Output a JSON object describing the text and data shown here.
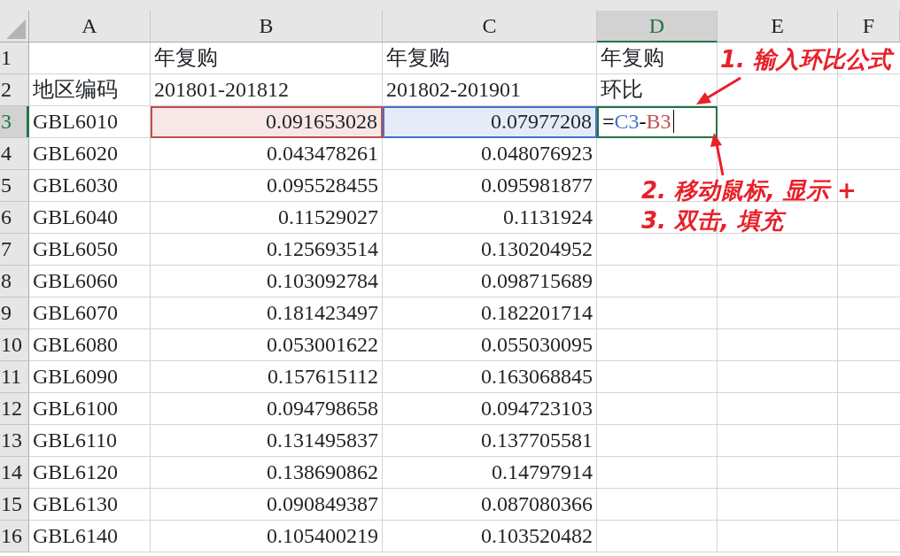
{
  "columns": [
    {
      "label": "A",
      "selected": false
    },
    {
      "label": "B",
      "selected": false
    },
    {
      "label": "C",
      "selected": false
    },
    {
      "label": "D",
      "selected": true
    },
    {
      "label": "E",
      "selected": false
    },
    {
      "label": "F",
      "selected": false
    }
  ],
  "rows": [
    {
      "label": "1",
      "selected": false,
      "cells": [
        "",
        "年复购",
        "年复购",
        "年复购"
      ]
    },
    {
      "label": "2",
      "selected": false,
      "cells": [
        "地区编码",
        "201801-201812",
        "201802-201901",
        "环比"
      ]
    },
    {
      "label": "3",
      "selected": true,
      "cells": [
        "GBL6010",
        {
          "text": "0.091653028",
          "color": "#c0504d"
        },
        {
          "text": "0.07977208",
          "color": "#4472c4"
        },
        {
          "editing": true,
          "formula": [
            {
              "text": "=",
              "color": "#000000"
            },
            {
              "text": "C3",
              "color": "#4472c4"
            },
            {
              "text": "-",
              "color": "#000000"
            },
            {
              "text": "B3",
              "color": "#c0504d"
            }
          ]
        }
      ]
    },
    {
      "label": "4",
      "selected": false,
      "cells": [
        "GBL6020",
        "0.043478261",
        "0.048076923"
      ]
    },
    {
      "label": "5",
      "selected": false,
      "cells": [
        "GBL6030",
        "0.095528455",
        "0.095981877"
      ]
    },
    {
      "label": "6",
      "selected": false,
      "cells": [
        "GBL6040",
        "0.11529027",
        "0.1131924"
      ]
    },
    {
      "label": "7",
      "selected": false,
      "cells": [
        "GBL6050",
        "0.125693514",
        "0.130204952"
      ]
    },
    {
      "label": "8",
      "selected": false,
      "cells": [
        "GBL6060",
        "0.103092784",
        "0.098715689"
      ]
    },
    {
      "label": "9",
      "selected": false,
      "cells": [
        "GBL6070",
        "0.181423497",
        "0.182201714"
      ]
    },
    {
      "label": "10",
      "selected": false,
      "cells": [
        "GBL6080",
        "0.053001622",
        "0.055030095"
      ]
    },
    {
      "label": "11",
      "selected": false,
      "cells": [
        "GBL6090",
        "0.157615112",
        "0.163068845"
      ]
    },
    {
      "label": "12",
      "selected": false,
      "cells": [
        "GBL6100",
        "0.094798658",
        "0.094723103"
      ]
    },
    {
      "label": "13",
      "selected": false,
      "cells": [
        "GBL6110",
        "0.131495837",
        "0.137705581"
      ]
    },
    {
      "label": "14",
      "selected": false,
      "cells": [
        "GBL6120",
        "0.138690862",
        "0.14797914"
      ]
    },
    {
      "label": "15",
      "selected": false,
      "cells": [
        "GBL6130",
        "0.090849387",
        "0.087080366"
      ]
    },
    {
      "label": "16",
      "selected": false,
      "cells": [
        "GBL6140",
        "0.105400219",
        "0.103520482"
      ]
    }
  ],
  "annotations": [
    {
      "text": "1. 输入环比公式"
    },
    {
      "text": "2. 移动鼠标, 显示 +"
    },
    {
      "text": "3. 双击, 填充"
    }
  ]
}
